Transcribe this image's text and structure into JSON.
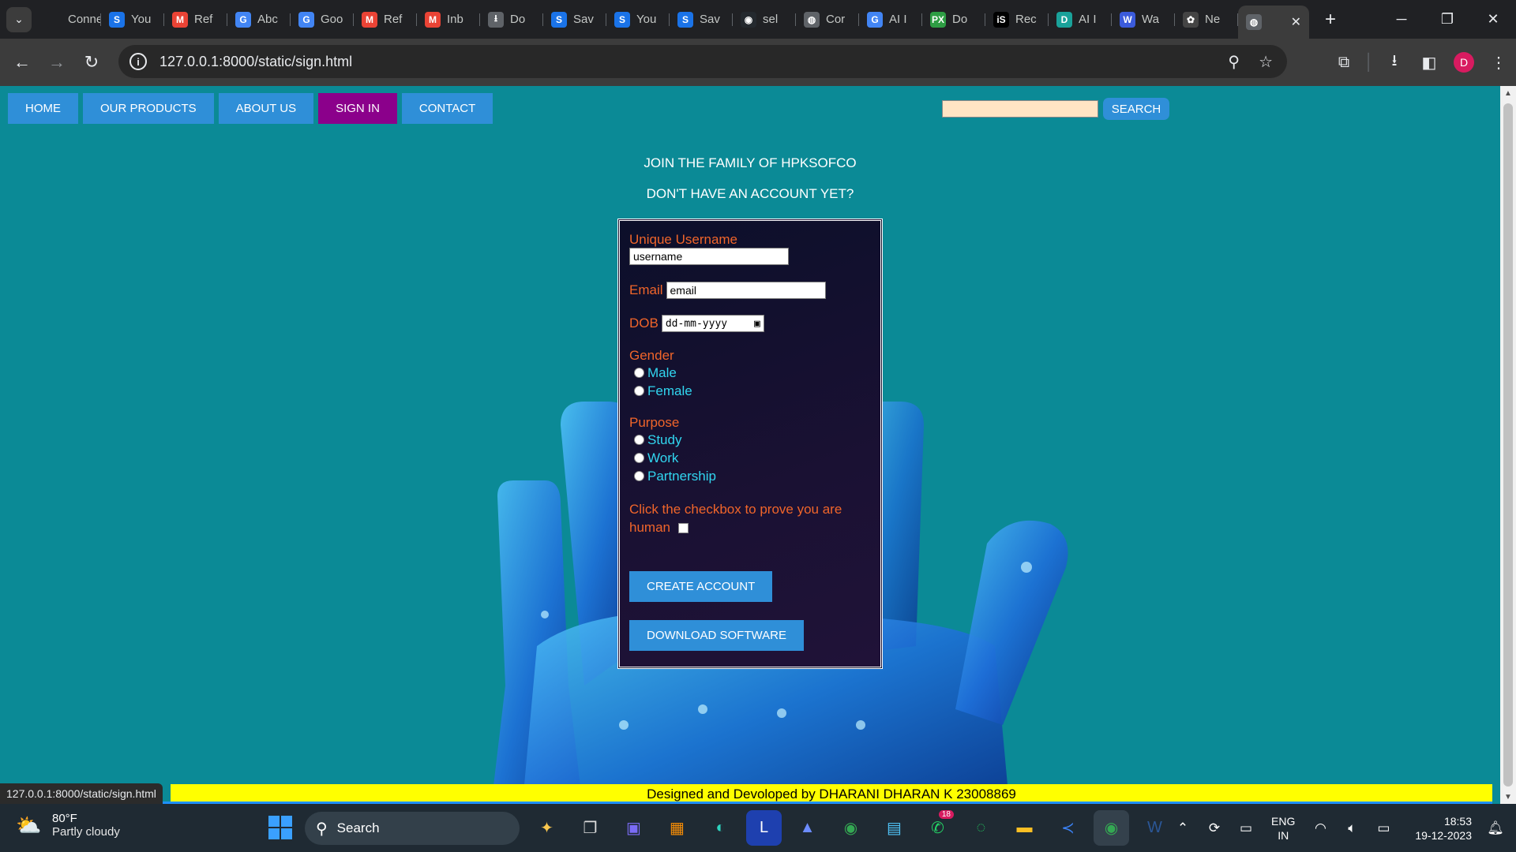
{
  "browser": {
    "tabs": [
      {
        "label": "Connec",
        "icon": "globe-icon",
        "fav_text": "",
        "color": "#202124"
      },
      {
        "label": "You",
        "icon": "s-icon",
        "fav_text": "S",
        "color": "#1a73e8"
      },
      {
        "label": "Ref",
        "icon": "gmail-icon",
        "fav_text": "M",
        "color": "#ea4335"
      },
      {
        "label": "Abc",
        "icon": "google-icon",
        "fav_text": "G",
        "color": "#4285f4"
      },
      {
        "label": "Goo",
        "icon": "google-icon",
        "fav_text": "G",
        "color": "#4285f4"
      },
      {
        "label": "Ref",
        "icon": "gmail-icon",
        "fav_text": "M",
        "color": "#ea4335"
      },
      {
        "label": "Inb",
        "icon": "gmail-icon",
        "fav_text": "M",
        "color": "#ea4335"
      },
      {
        "label": "Do",
        "icon": "download-icon",
        "fav_text": "⭳",
        "color": "#5f6368"
      },
      {
        "label": "Sav",
        "icon": "s-icon",
        "fav_text": "S",
        "color": "#1a73e8"
      },
      {
        "label": "You",
        "icon": "s-icon",
        "fav_text": "S",
        "color": "#1a73e8"
      },
      {
        "label": "Sav",
        "icon": "s-icon",
        "fav_text": "S",
        "color": "#1a73e8"
      },
      {
        "label": "sel",
        "icon": "github-icon",
        "fav_text": "◉",
        "color": "#24292e"
      },
      {
        "label": "Cor",
        "icon": "globe-icon",
        "fav_text": "◍",
        "color": "#5f6368"
      },
      {
        "label": "AI I",
        "icon": "google-icon",
        "fav_text": "G",
        "color": "#4285f4"
      },
      {
        "label": "Do",
        "icon": "px-icon",
        "fav_text": "PX",
        "color": "#2e9d44"
      },
      {
        "label": "Rec",
        "icon": "is-icon",
        "fav_text": "iS",
        "color": "#000000"
      },
      {
        "label": "AI I",
        "icon": "doc-icon",
        "fav_text": "D",
        "color": "#1aa29a"
      },
      {
        "label": "Wa",
        "icon": "w-icon",
        "fav_text": "W",
        "color": "#3b5bdb"
      },
      {
        "label": "Ne",
        "icon": "chatgpt-icon",
        "fav_text": "✿",
        "color": "#444"
      }
    ],
    "active_tab_icon": "globe-icon",
    "url": "127.0.0.1:8000/static/sign.html",
    "profile_initial": "D"
  },
  "nav": {
    "items": [
      {
        "label": "HOME",
        "active": false
      },
      {
        "label": "OUR PRODUCTS",
        "active": false
      },
      {
        "label": "ABOUT US",
        "active": false
      },
      {
        "label": "SIGN IN",
        "active": true
      },
      {
        "label": "CONTACT",
        "active": false
      }
    ],
    "search_button": "SEARCH",
    "search_value": ""
  },
  "page": {
    "heading1": "JOIN THE FAMILY OF HPKSOFCO",
    "heading2": "DON'T HAVE AN ACCOUNT YET?"
  },
  "form": {
    "username_label": "Unique Username",
    "username_value": "username",
    "email_label": "Email",
    "email_value": "email",
    "dob_label": "DOB",
    "dob_placeholder": "dd-mm-yyyy",
    "gender_label": "Gender",
    "gender_options": [
      "Male",
      "Female"
    ],
    "purpose_label": "Purpose",
    "purpose_options": [
      "Study",
      "Work",
      "Partnership"
    ],
    "human_label_1": "Click the checkbox to prove you are",
    "human_label_2": "human",
    "create_button": "CREATE ACCOUNT",
    "download_button": "DOWNLOAD SOFTWARE"
  },
  "footer": {
    "text": "Designed and Devoloped by DHARANI DHARAN K 23008869",
    "status_url": "127.0.0.1:8000/static/sign.html"
  },
  "taskbar": {
    "temperature": "80°F",
    "weather": "Partly cloudy",
    "search_label": "Search",
    "whatsapp_badge": "18",
    "language_1": "ENG",
    "language_2": "IN",
    "time": "18:53",
    "date": "19-12-2023"
  },
  "colors": {
    "page_bg": "#0b8a96",
    "nav_button": "#2f8fd8",
    "nav_active": "#8b008b",
    "label": "#f0652a",
    "option": "#31d6f0",
    "footer_bg": "#ffff00"
  }
}
